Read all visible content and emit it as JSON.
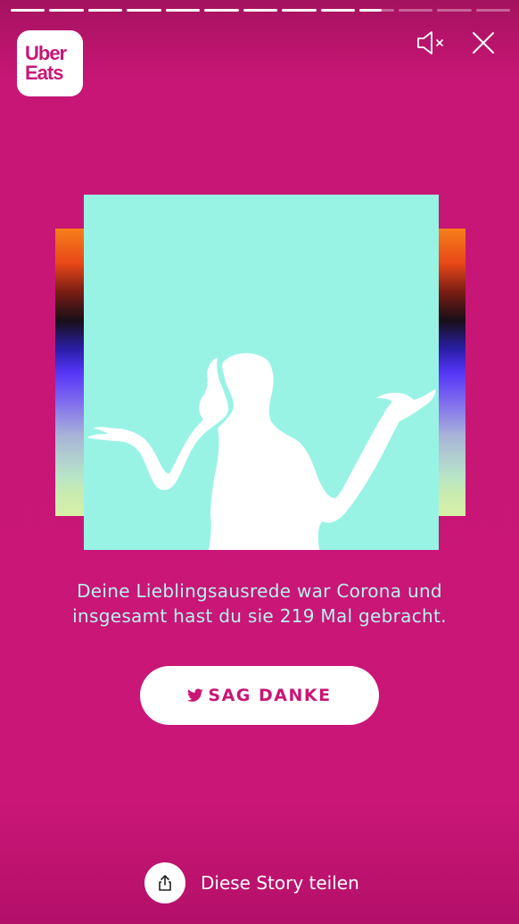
{
  "story": {
    "progress": {
      "total_segments": 13,
      "completed_segments": 9,
      "current_fraction": 0.65
    }
  },
  "brand": {
    "line1": "Uber",
    "line2": "Eats"
  },
  "controls": {
    "mute_icon": "speaker-muted-icon",
    "close_icon": "close-icon"
  },
  "colors": {
    "background": "#c81676",
    "accent": "#c81676",
    "photo_background": "#98f3e5",
    "caption": "#b9f2ef"
  },
  "caption": {
    "line1": "Deine Lieblingsausrede war Corona und",
    "line2": "insgesamt hast du sie 219 Mal gebracht."
  },
  "thanks_button": {
    "icon": "twitter-bird-icon",
    "label": "SAG DANKE"
  },
  "share": {
    "icon": "share-icon",
    "label": "Diese Story teilen"
  }
}
